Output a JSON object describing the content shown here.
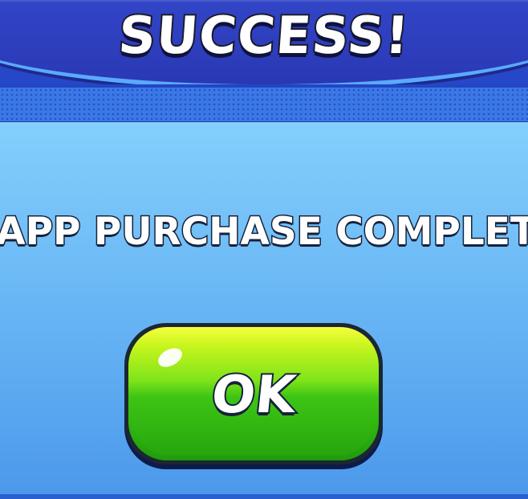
{
  "dialog": {
    "title": "SUCCESS!",
    "message": "IN-APP PURCHASE COMPLETED",
    "ok_label": "OK"
  },
  "colors": {
    "header_blue": "#3246c8",
    "strip_blue": "#3a78e8",
    "panel_blue": "#70bdf7",
    "button_green": "#3fc514",
    "button_yellow": "#f6ff3c",
    "outline": "#16213a"
  }
}
